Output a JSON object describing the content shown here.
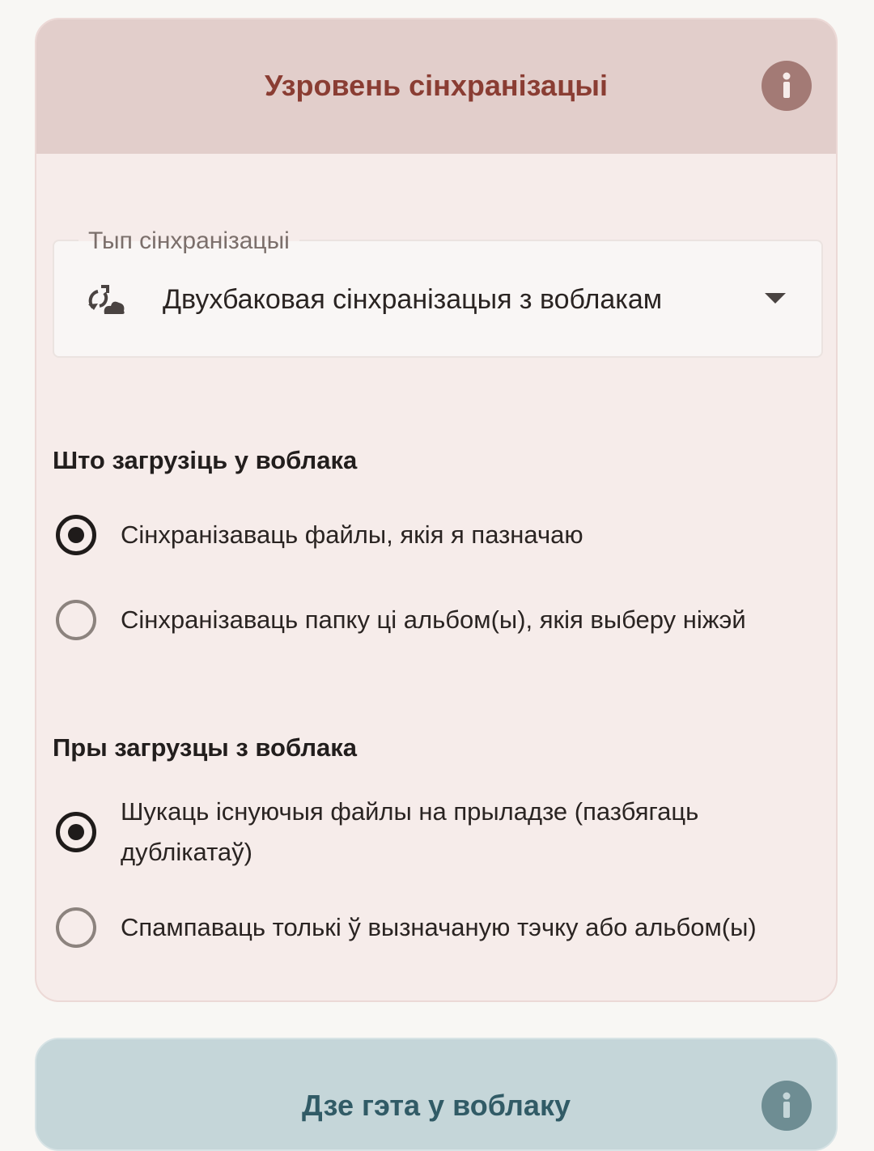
{
  "sync_card": {
    "title": "Узровень сінхранізацыі",
    "info_icon": "info-icon",
    "sync_type": {
      "label": "Тып сінхранізацыі",
      "value": "Двухбаковая сінхранізацыя з воблакам",
      "icon": "sync-cloud-icon"
    },
    "upload_section": {
      "title": "Што загрузіць у воблака",
      "options": [
        {
          "label": "Сінхранізаваць файлы, якія я пазначаю",
          "checked": true
        },
        {
          "label": "Сінхранізаваць папку ці альбом(ы), якія выберу ніжэй",
          "checked": false
        }
      ]
    },
    "download_section": {
      "title": "Пры загрузцы з воблака",
      "options": [
        {
          "label": "Шукаць існуючыя файлы на прыладзе (пазбягаць дублікатаў)",
          "checked": true
        },
        {
          "label": "Спампаваць толькі ў вызначаную тэчку або альбом(ы)",
          "checked": false
        }
      ]
    }
  },
  "cloud_card": {
    "title": "Дзе гэта у воблаку",
    "info_icon": "info-icon"
  },
  "colors": {
    "sync_accent": "#8a3d33",
    "cloud_accent": "#315b66"
  }
}
